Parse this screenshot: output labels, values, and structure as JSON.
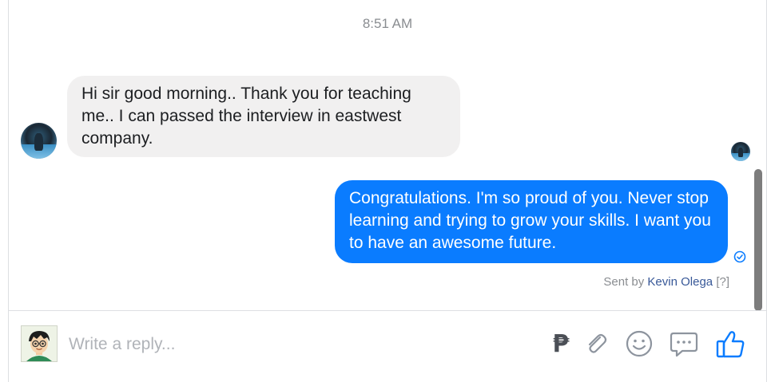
{
  "conversation": {
    "timestamp": "8:51 AM",
    "messages": [
      {
        "direction": "incoming",
        "text": "Hi sir good morning.. Thank you for teaching me.. I can passed the interview in eastwest company."
      },
      {
        "direction": "outgoing",
        "text": "Congratulations. I'm so proud of you. Never stop learning and trying to grow your skills. I want you to have an awesome future."
      }
    ],
    "sent_by": {
      "prefix": "Sent by",
      "name": "Kevin Olega",
      "help": "[?]"
    }
  },
  "composer": {
    "placeholder": "Write a reply...",
    "tools": [
      "peso-icon",
      "paperclip-icon",
      "emoji-icon",
      "sticker-chat-icon",
      "thumbs-up-icon"
    ]
  },
  "colors": {
    "outgoing_bubble": "#0a7cff",
    "incoming_bubble": "#f1f0f0",
    "accent": "#0a7cff",
    "link_name": "#385898",
    "icon_gray": "#8d949e"
  }
}
